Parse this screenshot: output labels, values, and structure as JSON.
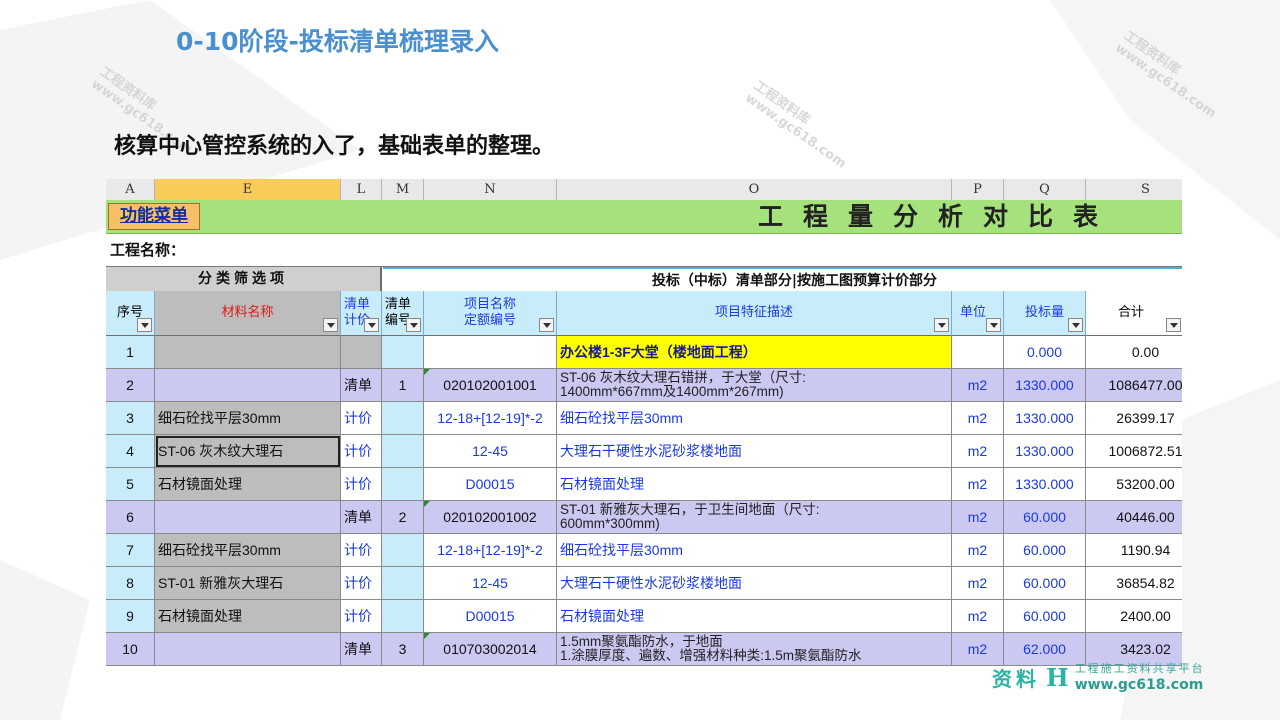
{
  "slide": {
    "title": "0-10阶段-投标清单梳理录入",
    "subtitle": "核算中心管控系统的入了，基础表单的整理。"
  },
  "watermark": {
    "site": "www.gc618.com",
    "name": "工程资料库"
  },
  "spreadsheet": {
    "column_headers": [
      "A",
      "E",
      "L",
      "M",
      "N",
      "O",
      "P",
      "Q",
      "S"
    ],
    "selected_column": "E",
    "menu_button": "功能菜单",
    "banner_title": "工程量分析对比表",
    "project_label": "工程名称：",
    "group_left": "分类筛选项",
    "group_right": "投标（中标）清单部分|按施工图预算计价部分",
    "headers": [
      {
        "text": "序号",
        "filter": true
      },
      {
        "text": "材料名称",
        "filter": true,
        "color": "#e01818"
      },
      {
        "text": "清单\n计价",
        "filter": true,
        "color": "#1a3ae0"
      },
      {
        "text": "清单\n编号",
        "filter": true
      },
      {
        "text": "项目名称\n定额编号",
        "filter": true,
        "color": "#1a3ae0"
      },
      {
        "text": "项目特征描述",
        "filter": true,
        "color": "#1a3ae0"
      },
      {
        "text": "单位",
        "filter": true,
        "color": "#1a3ae0"
      },
      {
        "text": "投标量",
        "filter": true,
        "color": "#1a3ae0"
      },
      {
        "text": "合计",
        "filter": true
      }
    ],
    "rows": [
      {
        "no": "1",
        "material": "",
        "type": "",
        "code": "",
        "item": "",
        "desc": "办公楼1-3F大堂（楼地面工程）",
        "desc2": "",
        "unit": "",
        "qty": "0.000",
        "total": "0.00",
        "kind": "section"
      },
      {
        "no": "2",
        "material": "",
        "type": "清单",
        "code": "1",
        "item": "020102001001",
        "desc": "ST-06 灰木纹大理石错拼，于大堂（尺寸:",
        "desc2": "1400mm*667mm及1400mm*267mm)",
        "unit": "m2",
        "qty": "1330.000",
        "total": "1086477.00",
        "kind": "list"
      },
      {
        "no": "3",
        "material": "细石砼找平层30mm",
        "type": "计价",
        "code": "",
        "item": "12-18+[12-19]*-2",
        "desc": "细石砼找平层30mm",
        "desc2": "",
        "unit": "m2",
        "qty": "1330.000",
        "total": "26399.17",
        "kind": "price"
      },
      {
        "no": "4",
        "material": "ST-06 灰木纹大理石",
        "type": "计价",
        "code": "",
        "item": "12-45",
        "desc": "大理石干硬性水泥砂浆楼地面",
        "desc2": "",
        "unit": "m2",
        "qty": "1330.000",
        "total": "1006872.51",
        "kind": "price",
        "selected": true
      },
      {
        "no": "5",
        "material": "石材镜面处理",
        "type": "计价",
        "code": "",
        "item": "D00015",
        "desc": "石材镜面处理",
        "desc2": "",
        "unit": "m2",
        "qty": "1330.000",
        "total": "53200.00",
        "kind": "price"
      },
      {
        "no": "6",
        "material": "",
        "type": "清单",
        "code": "2",
        "item": "020102001002",
        "desc": "ST-01 新雅灰大理石，于卫生间地面（尺寸:",
        "desc2": "600mm*300mm)",
        "unit": "m2",
        "qty": "60.000",
        "total": "40446.00",
        "kind": "list"
      },
      {
        "no": "7",
        "material": "细石砼找平层30mm",
        "type": "计价",
        "code": "",
        "item": "12-18+[12-19]*-2",
        "desc": "细石砼找平层30mm",
        "desc2": "",
        "unit": "m2",
        "qty": "60.000",
        "total": "1190.94",
        "kind": "price"
      },
      {
        "no": "8",
        "material": "ST-01 新雅灰大理石",
        "type": "计价",
        "code": "",
        "item": "12-45",
        "desc": "大理石干硬性水泥砂浆楼地面",
        "desc2": "",
        "unit": "m2",
        "qty": "60.000",
        "total": "36854.82",
        "kind": "price"
      },
      {
        "no": "9",
        "material": "石材镜面处理",
        "type": "计价",
        "code": "",
        "item": "D00015",
        "desc": "石材镜面处理",
        "desc2": "",
        "unit": "m2",
        "qty": "60.000",
        "total": "2400.00",
        "kind": "price"
      },
      {
        "no": "10",
        "material": "",
        "type": "清单",
        "code": "3",
        "item": "010703002014",
        "desc": "1.5mm聚氨酯防水，于地面",
        "desc2": "1.涂膜厚度、遍数、增强材料种类:1.5m聚氨酯防水",
        "unit": "m2",
        "qty": "62.000",
        "total": "3423.02",
        "kind": "list"
      }
    ]
  },
  "logo": {
    "text": "资料",
    "mark": "H",
    "tagline": "工程施工资料共享平台",
    "url": "www.gc618.com"
  },
  "colors": {
    "title": "#4a90d0",
    "banner": "#a6e27c",
    "list_row": "#cbc8f2",
    "section": "#ffff00",
    "link_blue": "#1a3ae0"
  }
}
